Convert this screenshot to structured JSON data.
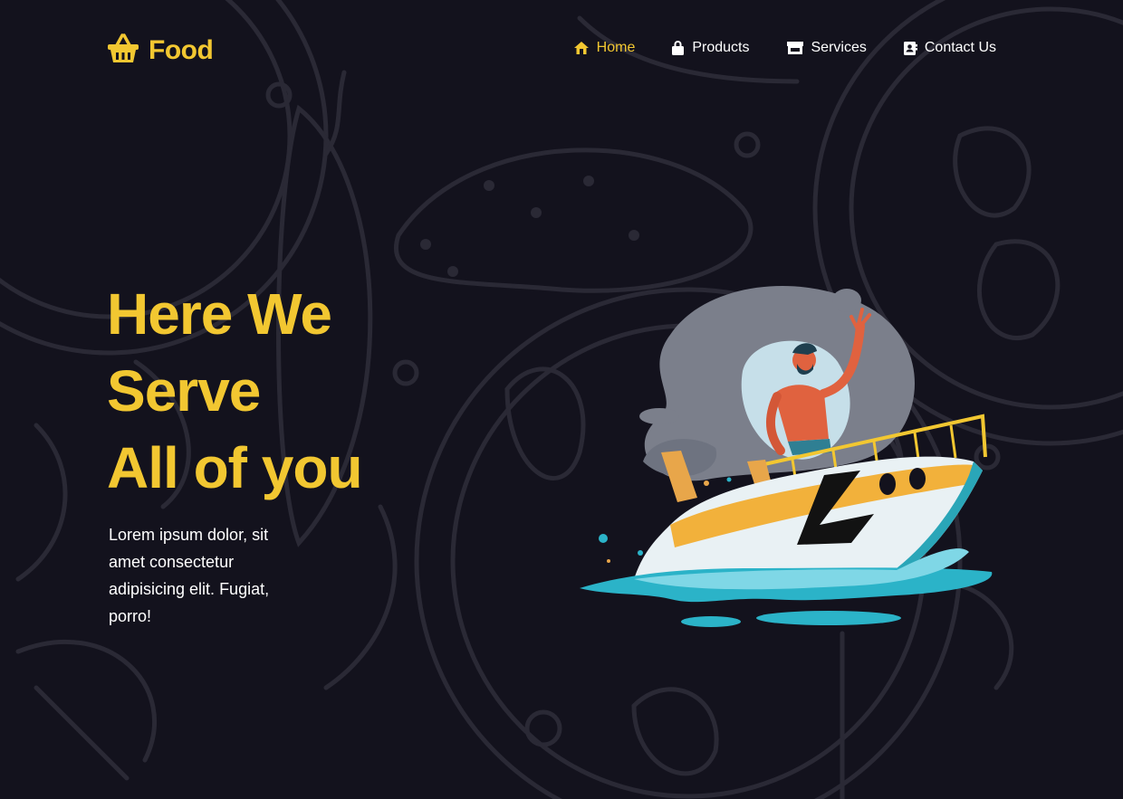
{
  "brand": {
    "name": "Food",
    "icon": "basket-icon"
  },
  "nav": {
    "items": [
      {
        "label": "Home",
        "icon": "home-icon",
        "active": true
      },
      {
        "label": "Products",
        "icon": "shopping-bag-icon",
        "active": false
      },
      {
        "label": "Services",
        "icon": "store-icon",
        "active": false
      },
      {
        "label": "Contact Us",
        "icon": "address-book-icon",
        "active": false
      }
    ]
  },
  "hero": {
    "title_lines": [
      "Here We",
      "Serve",
      "All of you"
    ],
    "text": "Lorem ipsum dolor, sit amet consectetur adipisicing elit. Fugiat, porro!",
    "illustration": "man-on-speedboat-illustration"
  },
  "colors": {
    "accent": "#f2c731",
    "background": "#13121d",
    "doodle": "#2a2935",
    "text": "#ffffff"
  }
}
